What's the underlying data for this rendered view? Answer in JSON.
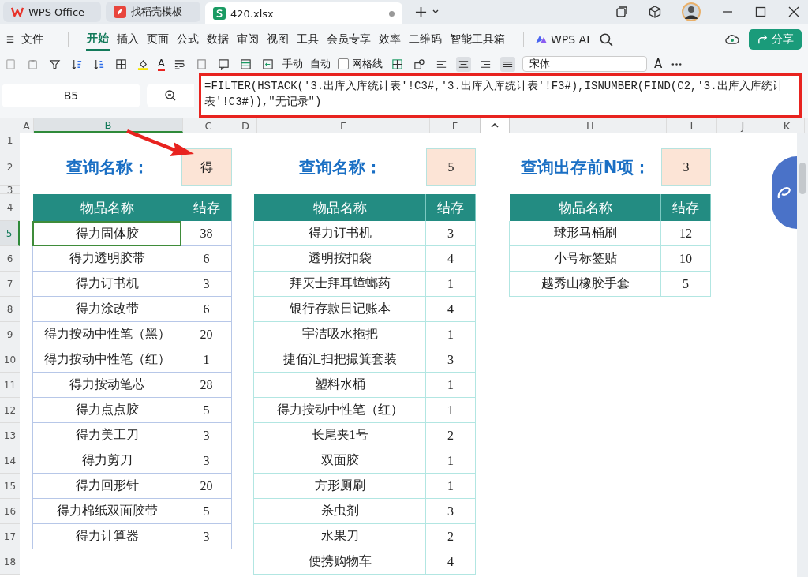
{
  "tabs": [
    {
      "kind": "home",
      "label": "WPS Office",
      "selected": false
    },
    {
      "kind": "template",
      "label": "找稻壳模板",
      "selected": false
    },
    {
      "kind": "sheet",
      "label": "420.xlsx",
      "selected": true
    }
  ],
  "menu": {
    "file": "文件",
    "items": [
      {
        "label": "开始",
        "selected": true
      },
      {
        "label": "插入",
        "selected": false
      },
      {
        "label": "页面",
        "selected": false
      },
      {
        "label": "公式",
        "selected": false
      },
      {
        "label": "数据",
        "selected": false
      },
      {
        "label": "审阅",
        "selected": false
      },
      {
        "label": "视图",
        "selected": false
      },
      {
        "label": "工具",
        "selected": false
      },
      {
        "label": "会员专享",
        "selected": false
      },
      {
        "label": "效率",
        "selected": false
      },
      {
        "label": "二维码",
        "selected": false
      },
      {
        "label": "智能工具箱",
        "selected": false
      }
    ],
    "ai": "WPS AI",
    "share": "分享"
  },
  "toolbar": {
    "font_color": "A",
    "calc_manual": "手动",
    "calc_auto": "自动",
    "gridlines": {
      "label": "网格线",
      "checked": false
    },
    "font": "宋体",
    "grow_font": "A"
  },
  "formula_bar": {
    "name_box": "B5",
    "formula": "=FILTER(HSTACK('3.出库入库统计表'!C3#,'3.出库入库统计表'!F3#),ISNUMBER(FIND(C2,'3.出库入库统计表'!C3#)),\"无记录\")"
  },
  "columns": [
    {
      "label": "A",
      "selected": false
    },
    {
      "label": "B",
      "selected": true
    },
    {
      "label": "C",
      "selected": false
    },
    {
      "label": "D",
      "selected": false
    },
    {
      "label": "E",
      "selected": false
    },
    {
      "label": "F",
      "selected": false
    },
    {
      "label": "H",
      "selected": false
    },
    {
      "label": "I",
      "selected": false
    },
    {
      "label": "J",
      "selected": false
    },
    {
      "label": "K",
      "selected": false
    }
  ],
  "rows": [
    {
      "label": "1",
      "selected": false
    },
    {
      "label": "2",
      "selected": false
    },
    {
      "label": "3",
      "selected": false
    },
    {
      "label": "4",
      "selected": false
    },
    {
      "label": "5",
      "selected": true
    },
    {
      "label": "6",
      "selected": false
    },
    {
      "label": "7",
      "selected": false
    },
    {
      "label": "8",
      "selected": false
    },
    {
      "label": "9",
      "selected": false
    },
    {
      "label": "10",
      "selected": false
    },
    {
      "label": "11",
      "selected": false
    },
    {
      "label": "12",
      "selected": false
    },
    {
      "label": "13",
      "selected": false
    },
    {
      "label": "14",
      "selected": false
    },
    {
      "label": "15",
      "selected": false
    },
    {
      "label": "16",
      "selected": false
    },
    {
      "label": "17",
      "selected": false
    },
    {
      "label": "18",
      "selected": false
    }
  ],
  "queries": [
    {
      "label": "查询名称：",
      "value": "得"
    },
    {
      "label": "查询名称：",
      "value": "5"
    },
    {
      "label": "查询出存前N项：",
      "value": "3"
    }
  ],
  "tables": [
    {
      "columns": [
        "物品名称",
        "结存"
      ],
      "rows": [
        {
          "cells": [
            "得力固体胶",
            "38"
          ],
          "selected": true
        },
        {
          "cells": [
            "得力透明胶带",
            "6"
          ],
          "selected": false
        },
        {
          "cells": [
            "得力订书机",
            "3"
          ],
          "selected": false
        },
        {
          "cells": [
            "得力涂改带",
            "6"
          ],
          "selected": false
        },
        {
          "cells": [
            "得力按动中性笔（黑）",
            "20"
          ],
          "selected": false
        },
        {
          "cells": [
            "得力按动中性笔（红）",
            "1"
          ],
          "selected": false
        },
        {
          "cells": [
            "得力按动笔芯",
            "28"
          ],
          "selected": false
        },
        {
          "cells": [
            "得力点点胶",
            "5"
          ],
          "selected": false
        },
        {
          "cells": [
            "得力美工刀",
            "3"
          ],
          "selected": false
        },
        {
          "cells": [
            "得力剪刀",
            "3"
          ],
          "selected": false
        },
        {
          "cells": [
            "得力回形针",
            "20"
          ],
          "selected": false
        },
        {
          "cells": [
            "得力棉纸双面胶带",
            "5"
          ],
          "selected": false
        },
        {
          "cells": [
            "得力计算器",
            "3"
          ],
          "selected": false
        }
      ]
    },
    {
      "columns": [
        "物品名称",
        "结存"
      ],
      "rows": [
        {
          "cells": [
            "得力订书机",
            "3"
          ],
          "selected": false
        },
        {
          "cells": [
            "透明按扣袋",
            "4"
          ],
          "selected": false
        },
        {
          "cells": [
            "拜灭士拜耳蟑螂药",
            "1"
          ],
          "selected": false
        },
        {
          "cells": [
            "银行存款日记账本",
            "4"
          ],
          "selected": false
        },
        {
          "cells": [
            "宇洁吸水拖把",
            "1"
          ],
          "selected": false
        },
        {
          "cells": [
            "捷佰汇扫把撮箕套装",
            "3"
          ],
          "selected": false
        },
        {
          "cells": [
            "塑料水桶",
            "1"
          ],
          "selected": false
        },
        {
          "cells": [
            "得力按动中性笔（红）",
            "1"
          ],
          "selected": false
        },
        {
          "cells": [
            "长尾夹1号",
            "2"
          ],
          "selected": false
        },
        {
          "cells": [
            "双面胶",
            "1"
          ],
          "selected": false
        },
        {
          "cells": [
            "方形厕刷",
            "1"
          ],
          "selected": false
        },
        {
          "cells": [
            "杀虫剂",
            "3"
          ],
          "selected": false
        },
        {
          "cells": [
            "水果刀",
            "2"
          ],
          "selected": false
        },
        {
          "cells": [
            "便携购物车",
            "4"
          ],
          "selected": false
        }
      ]
    },
    {
      "columns": [
        "物品名称",
        "结存"
      ],
      "rows": [
        {
          "cells": [
            "球形马桶刷",
            "12"
          ],
          "selected": false
        },
        {
          "cells": [
            "小号标签贴",
            "10"
          ],
          "selected": false
        },
        {
          "cells": [
            "越秀山橡胶手套",
            "5"
          ],
          "selected": false
        }
      ]
    }
  ]
}
